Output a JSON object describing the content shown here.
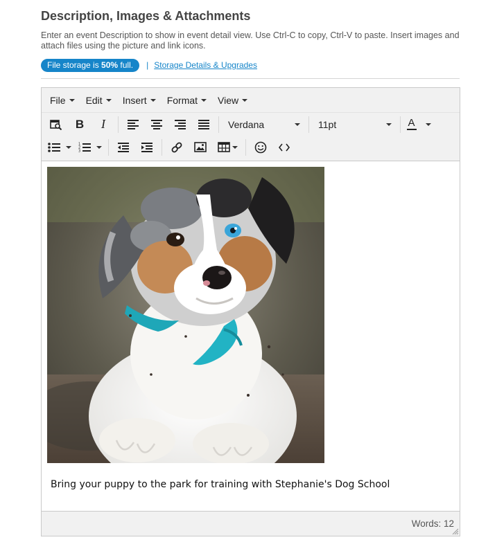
{
  "section": {
    "title": "Description, Images & Attachments",
    "help": "Enter an event Description to show in event detail view. Use Ctrl-C to copy, Ctrl-V to paste. Insert images and attach files using the picture and link icons."
  },
  "storage": {
    "prefix": "File storage is",
    "percent": "50%",
    "suffix": "full.",
    "separator": "|",
    "link": "Storage Details & Upgrades",
    "badge_color": "#1685c9"
  },
  "editor": {
    "menu": [
      "File",
      "Edit",
      "Insert",
      "Format",
      "View"
    ],
    "font_family": "Verdana",
    "font_size": "11pt",
    "text_color_label": "A",
    "text_color_swatch": "#222222",
    "icons": [
      "find-replace-icon",
      "bold-icon",
      "italic-icon",
      "align-left-icon",
      "align-center-icon",
      "align-right-icon",
      "align-justify-icon",
      "bullet-list-icon",
      "numbered-list-icon",
      "outdent-icon",
      "indent-icon",
      "link-icon",
      "image-icon",
      "table-icon",
      "emoticon-icon",
      "source-code-icon"
    ],
    "bold_label": "B",
    "italic_label": "I",
    "content_text": "Bring your puppy to the park for training with Stephanie's Dog School",
    "word_count": "Words: 12"
  }
}
